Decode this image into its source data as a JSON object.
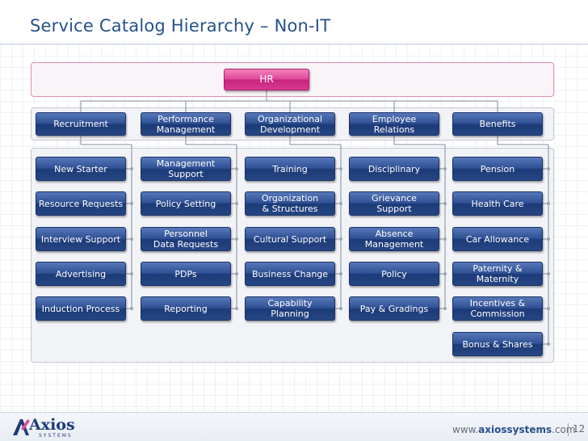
{
  "title": "Service Catalog Hierarchy – Non-IT",
  "root": "HR",
  "categories": [
    {
      "name": "Recruitment",
      "children": [
        "New Starter",
        "Resource Requests",
        "Interview Support",
        "Advertising",
        "Induction Process"
      ]
    },
    {
      "name": "Performance\nManagement",
      "children": [
        "Management\nSupport",
        "Policy Setting",
        "Personnel\nData Requests",
        "PDPs",
        "Reporting"
      ]
    },
    {
      "name": "Organizational\nDevelopment",
      "children": [
        "Training",
        "Organization\n& Structures",
        "Cultural Support",
        "Business Change",
        "Capability\nPlanning"
      ]
    },
    {
      "name": "Employee\nRelations",
      "children": [
        "Disciplinary",
        "Grievance\nSupport",
        "Absence\nManagement",
        "Policy",
        "Pay & Gradings"
      ]
    },
    {
      "name": "Benefits",
      "children": [
        "Pension",
        "Health Care",
        "Car Allowance",
        "Paternity &\nMaternity",
        "Incentives &\nCommission",
        "Bonus & Shares"
      ]
    }
  ],
  "footer": {
    "logo_word": "Axios",
    "logo_sub": "SYSTEMS",
    "url_prefix": "www.",
    "url_brand": "axiossystems",
    "url_suffix": ".com",
    "page_number": "12"
  },
  "colors": {
    "box_blue": "#2e4f93",
    "box_pink": "#e0469a",
    "title": "#27518a"
  }
}
